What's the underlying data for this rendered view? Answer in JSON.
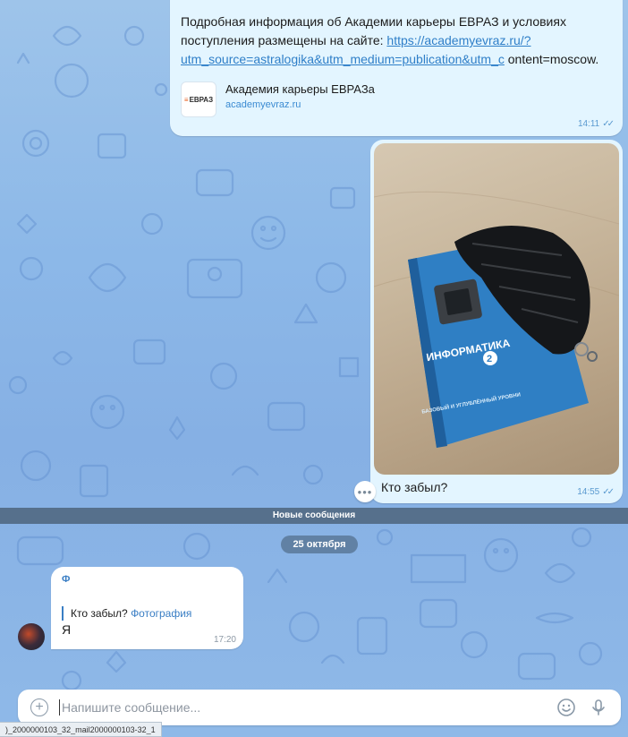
{
  "colors": {
    "bubble_out": "#e3f5ff",
    "bubble_in": "#ffffff",
    "link": "#2f7fc8",
    "accent": "#3a7ec4"
  },
  "messages": {
    "info": {
      "text_before_link": "Подробная информация об Академии карьеры ЕВРАЗ и условиях поступления размещены на сайте: ",
      "link": "https://academyevraz.ru/?utm_source=astralogika&utm_medium=publication&utm_c",
      "text_after_link": " ontent=moscow.",
      "preview_logo": "ЕВРАЗ",
      "preview_title": "Академия карьеры ЕВРАЗа",
      "preview_site": "academyevraz.ru",
      "time": "14:11"
    },
    "photo": {
      "book_title": "ИНФОРМАТИКА",
      "book_number": "2",
      "book_subtitle": "БАЗОВЫЙ И УГЛУБЛЁННЫЙ УРОВНИ",
      "caption": "Кто забыл?",
      "time": "14:55"
    },
    "incoming": {
      "sender": "Ф",
      "reply_text": "Кто забыл?",
      "reply_ref": "Фотография",
      "body": "Я",
      "time": "17:20"
    }
  },
  "separators": {
    "new_messages": "Новые сообщения",
    "date": "25 октября"
  },
  "composer": {
    "placeholder": "Напишите сообщение..."
  },
  "status_tip": ")_2000000103_32_mail2000000103-32_1",
  "icons": {
    "attach": "plus-circle-icon",
    "emoji": "smile-icon",
    "mic": "microphone-icon",
    "more": "ellipsis-icon",
    "read": "double-check-icon"
  }
}
